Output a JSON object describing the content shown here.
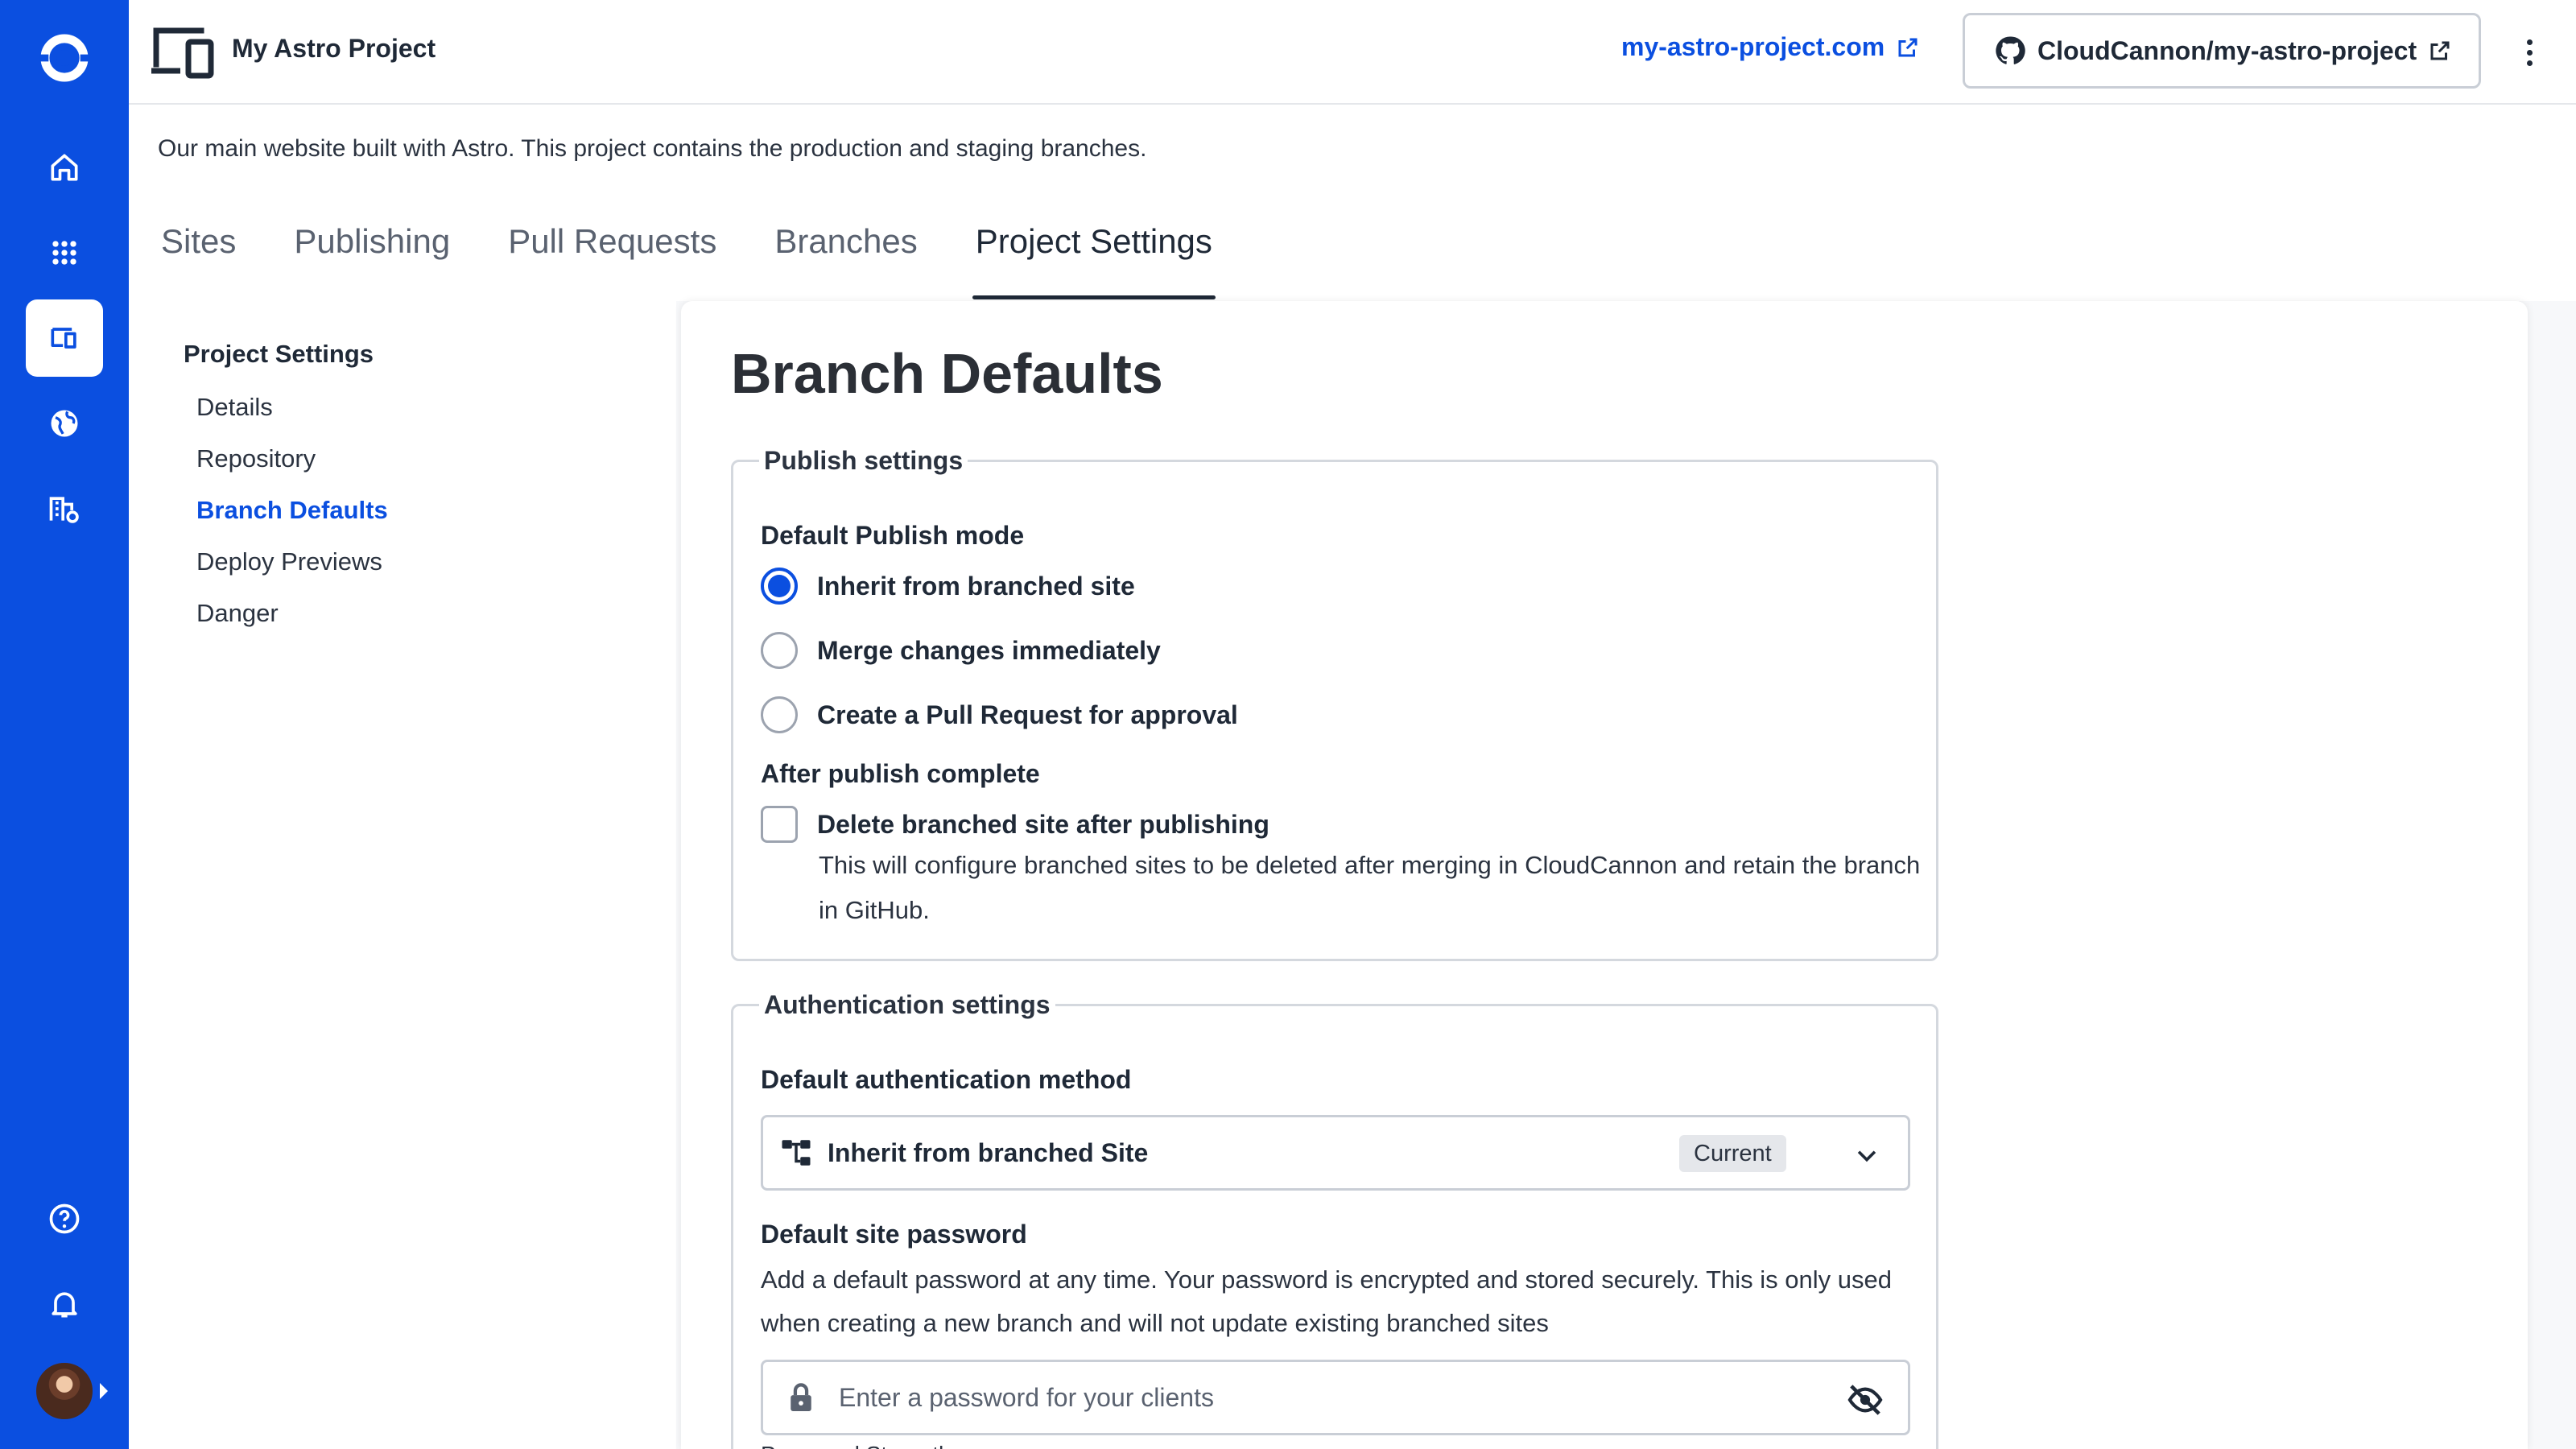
{
  "app": {
    "project_name": "My Astro Project",
    "site_link": "my-astro-project.com",
    "repo_link": "CloudCannon/my-astro-project",
    "description": "Our main website built with Astro. This project contains the production and staging branches."
  },
  "rail": {
    "items": [
      {
        "icon": "home-icon"
      },
      {
        "icon": "apps-grid-icon"
      },
      {
        "icon": "devices-icon",
        "active": true
      },
      {
        "icon": "globe-icon"
      },
      {
        "icon": "organization-settings-icon"
      }
    ],
    "bottom": [
      {
        "icon": "help-icon"
      },
      {
        "icon": "bell-icon"
      }
    ]
  },
  "tabs": [
    {
      "label": "Sites"
    },
    {
      "label": "Publishing"
    },
    {
      "label": "Pull Requests"
    },
    {
      "label": "Branches"
    },
    {
      "label": "Project Settings",
      "active": true
    }
  ],
  "settings_nav": {
    "heading": "Project Settings",
    "items": [
      {
        "label": "Details"
      },
      {
        "label": "Repository"
      },
      {
        "label": "Branch Defaults",
        "active": true
      },
      {
        "label": "Deploy Previews"
      },
      {
        "label": "Danger"
      }
    ]
  },
  "page": {
    "title": "Branch Defaults",
    "publish_settings": {
      "legend": "Publish settings",
      "mode_label": "Default Publish mode",
      "options": [
        {
          "label": "Inherit from branched site",
          "checked": true
        },
        {
          "label": "Merge changes immediately",
          "checked": false
        },
        {
          "label": "Create a Pull Request for approval",
          "checked": false
        }
      ],
      "after_label": "After publish complete",
      "delete_label": "Delete branched site after publishing",
      "delete_checked": false,
      "delete_help": "This will configure branched sites to be deleted after merging in CloudCannon and retain the branch in GitHub."
    },
    "auth_settings": {
      "legend": "Authentication settings",
      "method_label": "Default authentication method",
      "method_value": "Inherit from branched Site",
      "method_badge": "Current",
      "password_label": "Default site password",
      "password_help": "Add a default password at any time. Your password is encrypted and stored securely. This is only used when creating a new branch and will not update existing branched sites",
      "password_placeholder": "Enter a password for your clients",
      "password_strength": "Password Strength"
    }
  },
  "colors": {
    "brand": "#0b4fe0",
    "text": "#1f2937",
    "border": "#c9ced6"
  }
}
